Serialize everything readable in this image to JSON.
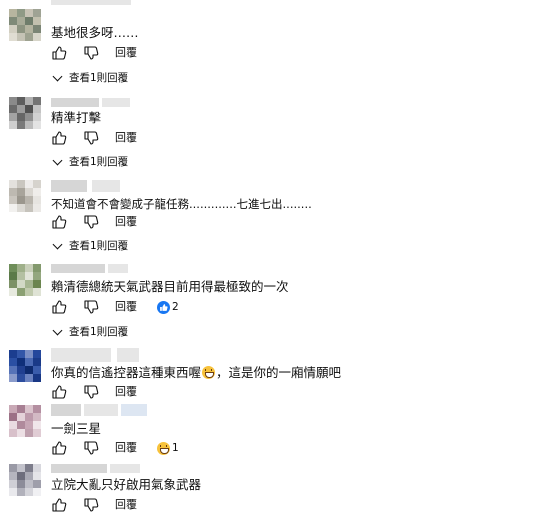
{
  "labels": {
    "reply": "回覆",
    "view_replies": "查看1則回覆"
  },
  "comments": [
    {
      "text": "基地很多呀……",
      "has_view_replies": true
    },
    {
      "text": "精準打擊",
      "has_view_replies": true
    },
    {
      "text": "不知道會不會變成子龍任務.............七進七出........",
      "has_view_replies": true
    },
    {
      "text": "賴清德總統天氣武器目前用得最極致的一次",
      "has_view_replies": true,
      "reaction": {
        "type": "like-icon",
        "count": "2"
      }
    },
    {
      "text_before": "你真的信遙控器這種東西喔",
      "text_emoji": "grinning-face-icon",
      "text_after": "，這是你的一廂情願吧",
      "has_view_replies": false
    },
    {
      "text": "一劍三星",
      "has_view_replies": false,
      "reaction": {
        "type": "laughing-face-icon",
        "count": "1"
      }
    },
    {
      "text": "立院大亂只好啟用氣象武器",
      "has_view_replies": false
    }
  ],
  "colors": {
    "text": "#0f0f0f",
    "blur": "#e6e6e6",
    "like_badge": "#1877f2",
    "emoji": "#f7c23b"
  }
}
